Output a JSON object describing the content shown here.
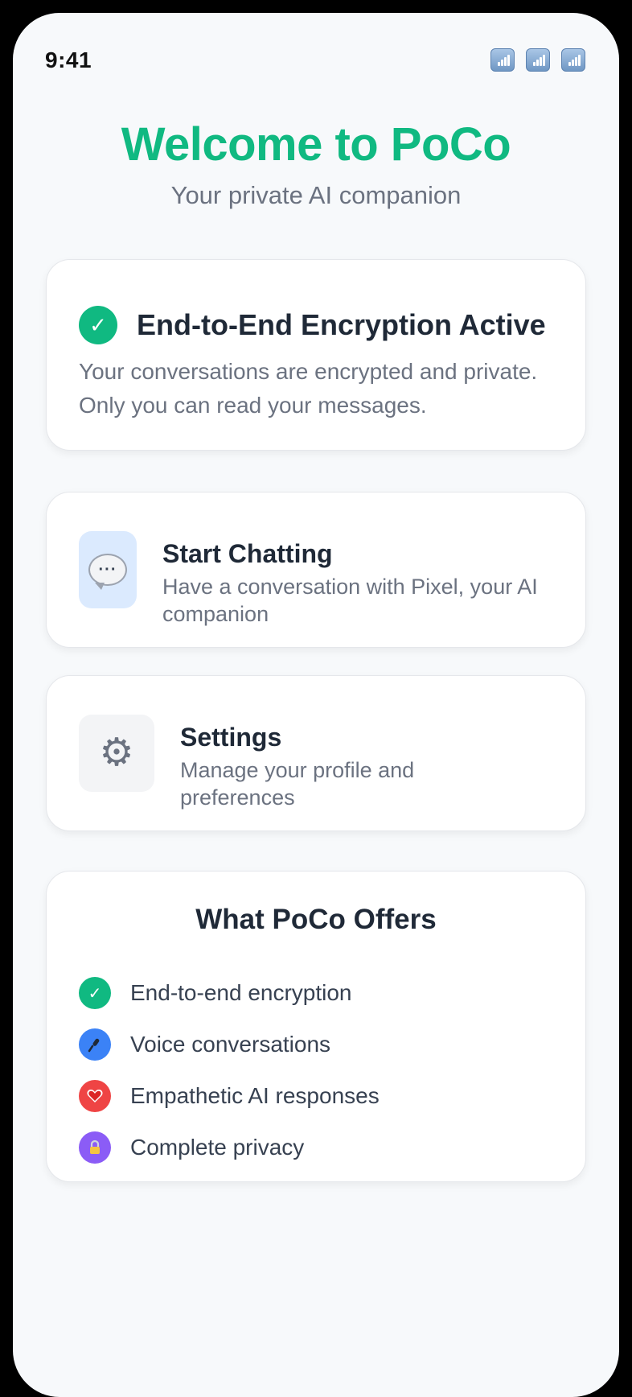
{
  "status": {
    "time": "9:41",
    "icons": [
      "signal-icon",
      "signal-icon",
      "signal-icon"
    ]
  },
  "header": {
    "title": "Welcome to PoCo",
    "subtitle": "Your private AI companion"
  },
  "encryption": {
    "title": "End-to-End Encryption Active",
    "description": "Your conversations are encrypted and private. Only you can read your messages.",
    "icon": "check-icon"
  },
  "actions": [
    {
      "title": "Start Chatting",
      "description": "Have a conversation with Pixel, your AI companion",
      "icon": "speech-bubble-icon"
    },
    {
      "title": "Settings",
      "description": "Manage your profile and preferences",
      "icon": "gear-icon"
    }
  ],
  "offers": {
    "title": "What PoCo Offers",
    "items": [
      {
        "label": "End-to-end encryption",
        "icon": "check-icon",
        "color": "#10b981"
      },
      {
        "label": "Voice conversations",
        "icon": "microphone-icon",
        "color": "#3b82f6"
      },
      {
        "label": "Empathetic AI responses",
        "icon": "heart-icon",
        "color": "#ef4444"
      },
      {
        "label": "Complete privacy",
        "icon": "lock-icon",
        "color": "#8b5cf6"
      }
    ]
  },
  "colors": {
    "accent": "#10b981",
    "background": "#f7f9fb"
  }
}
